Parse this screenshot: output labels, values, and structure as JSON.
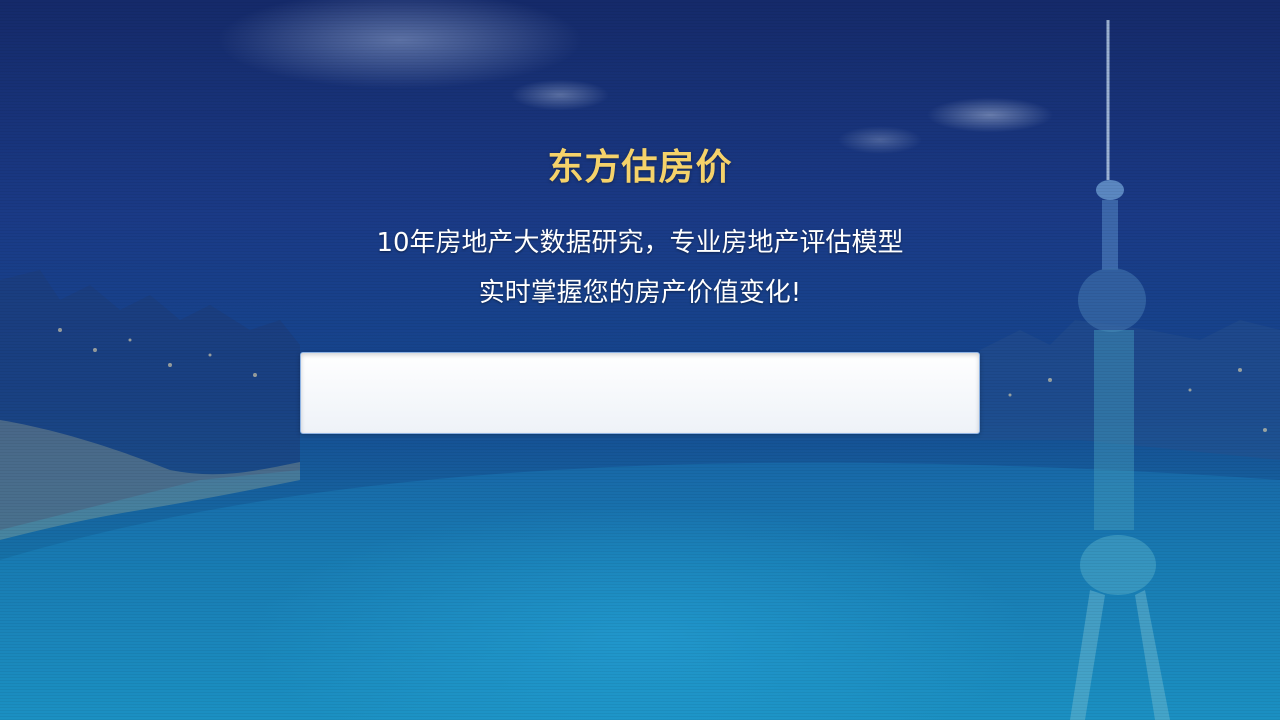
{
  "app": {
    "title": "东方估房价",
    "subtitle_line1": "10年房地产大数据研究，专业房地产评估模型",
    "subtitle_line2": "实时掌握您的房产价值变化!"
  },
  "search": {
    "value": "",
    "placeholder": ""
  },
  "background": {
    "description": "city-skyline-night"
  },
  "colors": {
    "title": "#f5d26a",
    "subtitle": "#ffffff",
    "input_border": "#8db2e3"
  }
}
